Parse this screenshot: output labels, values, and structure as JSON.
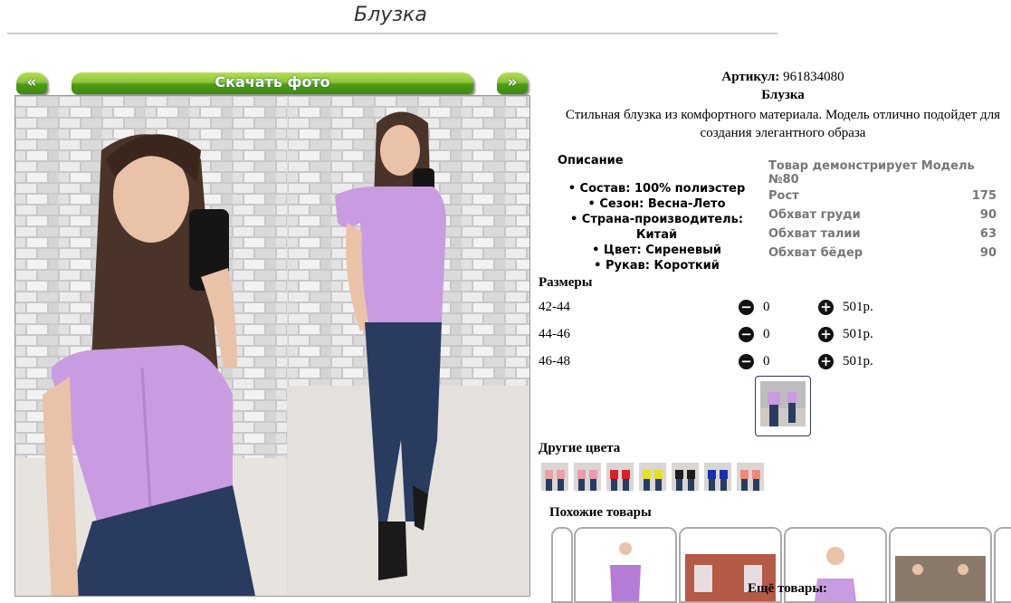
{
  "page": {
    "title": "Блузка"
  },
  "gallery": {
    "prev_label": "«",
    "download_label": "Скачать фото",
    "next_label": "»"
  },
  "product": {
    "article_label": "Артикул:",
    "article_value": "961834080",
    "name": "Блузка",
    "description": "Стильная блузка из комфортного материала. Модель отлично подойдет для создания элегантного образа"
  },
  "details": {
    "heading": "Описание",
    "items": [
      "Состав: 100% полиэстер",
      "Сезон: Весна-Лето",
      "Страна-производитель: Китай",
      "Цвет: Сиреневый",
      "Рукав: Короткий"
    ]
  },
  "model": {
    "rows": [
      {
        "label": "Товар демонстрирует Модель №80",
        "value": ""
      },
      {
        "label": "Рост",
        "value": "175"
      },
      {
        "label": "Обхват груди",
        "value": "90"
      },
      {
        "label": "Обхват талии",
        "value": "63"
      },
      {
        "label": "Обхват бёдер",
        "value": "90"
      }
    ]
  },
  "sizes": {
    "heading": "Размеры",
    "rows": [
      {
        "label": "42-44",
        "qty": "0",
        "price": "501р."
      },
      {
        "label": "44-46",
        "qty": "0",
        "price": "501р."
      },
      {
        "label": "46-48",
        "qty": "0",
        "price": "501р."
      }
    ]
  },
  "colors": {
    "heading": "Другие цвета",
    "swatches": [
      "#e8a0a8",
      "#e99bb0",
      "#d8232a",
      "#e5e020",
      "#1c1c1c",
      "#1a2fb0",
      "#f08878"
    ]
  },
  "similar": {
    "heading": "Похожие товары",
    "more_label": "Ещё товары:"
  },
  "colors_theme": {
    "button_green": "#5aa31c",
    "blouse": "#c79be0"
  }
}
